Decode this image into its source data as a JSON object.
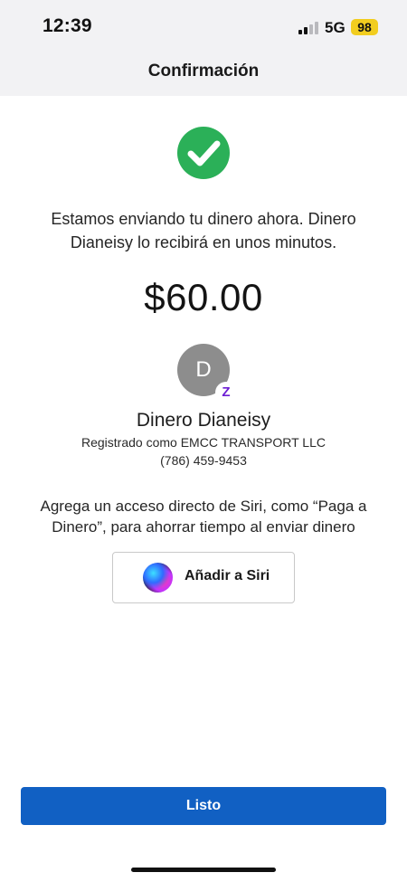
{
  "status_bar": {
    "time": "12:39",
    "network": "5G",
    "battery": "98",
    "signal_bars_active": 2,
    "signal_bars_total": 4,
    "battery_color": "#f2cd1f"
  },
  "nav": {
    "title": "Confirmación"
  },
  "confirmation": {
    "success_icon": "check-icon",
    "success_color": "#2bb058",
    "message": "Estamos enviando tu dinero ahora. Dinero Dianeisy lo recibirá en unos minutos.",
    "amount": "$60.00"
  },
  "recipient": {
    "initial": "D",
    "badge": "Z",
    "badge_color": "#6d1ed4",
    "name": "Dinero Dianeisy",
    "registered": "Registrado como EMCC TRANSPORT LLC",
    "phone": "(786) 459-9453"
  },
  "siri": {
    "prompt": "Agrega un acceso directo de Siri, como “Paga a Dinero”, para ahorrar tiempo al enviar dinero",
    "button_label": "Añadir a Siri",
    "icon": "siri-icon"
  },
  "footer": {
    "done_label": "Listo",
    "done_color": "#1160c3"
  }
}
